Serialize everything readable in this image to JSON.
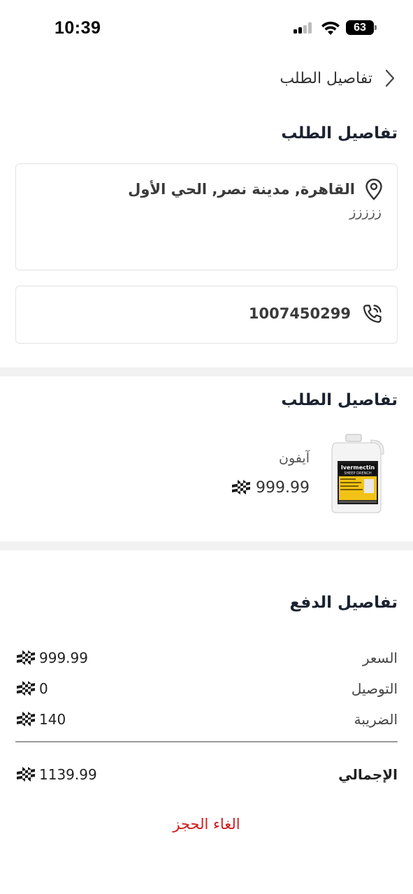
{
  "status_bar": {
    "time": "10:39",
    "battery": "63",
    "icons": [
      "signal-icon",
      "wifi-icon",
      "battery-icon"
    ]
  },
  "header": {
    "title": "تفاصيل الطلب",
    "back_icon": "chevron-right-icon"
  },
  "order_details": {
    "title": "تفاصيل الطلب",
    "address_main": "القاهرة, مدينة نصر, الحي الأول",
    "address_sub": "ززززز",
    "address_icon": "location-pin-icon",
    "phone": "1007450299",
    "phone_icon": "phone-icon"
  },
  "items_section": {
    "title": "تفاصيل الطلب",
    "items": [
      {
        "name": "آيفون",
        "price": "999.99",
        "currency_icon": "riyal-icon",
        "image_text": [
          "Ivermectin",
          "SHEEP DRENCH"
        ]
      }
    ]
  },
  "payment": {
    "title": "تفاصيل الدفع",
    "rows": [
      {
        "label": "السعر",
        "value": "999.99"
      },
      {
        "label": "التوصيل",
        "value": "0"
      },
      {
        "label": "الضريبة",
        "value": "140"
      }
    ],
    "total": {
      "label": "الإجمالي",
      "value": "1139.99"
    }
  },
  "cancel_label": "الغاء الحجز",
  "colors": {
    "danger": "#d21a1a",
    "band": "#f2f2f2",
    "border": "#e3e3e3"
  }
}
